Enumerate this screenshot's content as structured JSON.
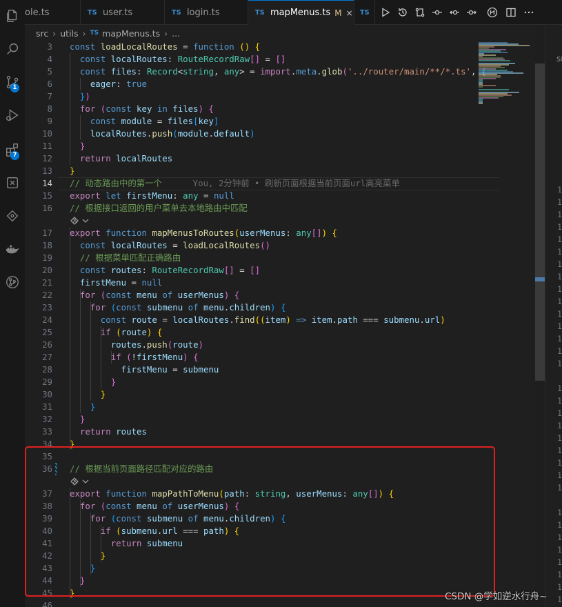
{
  "tabs": [
    {
      "name": "ole.ts",
      "icon": "ts-file-icon",
      "active": false
    },
    {
      "name": "user.ts",
      "icon": "ts-file-icon",
      "active": false
    },
    {
      "name": "login.ts",
      "icon": "ts-file-icon",
      "active": false
    },
    {
      "name": "mapMenus.ts",
      "icon": "ts-file-icon",
      "active": true,
      "modified": "M",
      "close": "×"
    },
    {
      "name": "",
      "icon": "ts-file-icon",
      "active": false
    }
  ],
  "ts_label": "TS",
  "breadcrumb": {
    "parts": [
      "src",
      "utils",
      "mapMenus.ts",
      "..."
    ]
  },
  "activity_badges": {
    "source_control": "1",
    "extensions": "7"
  },
  "editor": {
    "current_line": 14,
    "blame": "You, 2分钟前 • 刷新页面根据当前页面url高亮菜单",
    "lines": [
      {
        "n": "3",
        "html": "<span class=\"k\">const</span> <span class=\"f\">loadLocalRoutes</span> = <span class=\"k\">function</span> <span class=\"b1\">()</span> <span class=\"b1\">{</span>"
      },
      {
        "n": "4",
        "html": "  <span class=\"k\">const</span> <span class=\"v\">localRoutes</span>: <span class=\"t\">RouteRecordRaw</span><span class=\"b2\">[]</span> = <span class=\"b2\">[]</span>"
      },
      {
        "n": "5",
        "html": "  <span class=\"k\">const</span> <span class=\"v\">files</span>: <span class=\"t\">Record</span>&lt;<span class=\"t\">string</span>, <span class=\"t\">any</span>&gt; = <span class=\"kc\">import</span>.<span class=\"k\">meta</span>.<span class=\"f\">glob</span><span class=\"b2\">(</span><span class=\"s\">'../router/main/**/*.ts'</span>, <span class=\"b3\">{</span>"
      },
      {
        "n": "6",
        "html": "    <span class=\"v\">eager</span>: <span class=\"k\">true</span>"
      },
      {
        "n": "7",
        "html": "  <span class=\"b3\">}</span><span class=\"b2\">)</span>"
      },
      {
        "n": "8",
        "html": "  <span class=\"kc\">for</span> <span class=\"b2\">(</span><span class=\"k\">const</span> <span class=\"v\">key</span> <span class=\"k\">in</span> <span class=\"v\">files</span><span class=\"b2\">)</span> <span class=\"b2\">{</span>"
      },
      {
        "n": "9",
        "html": "    <span class=\"k\">const</span> <span class=\"v\">module</span> = <span class=\"v\">files</span><span class=\"b3\">[</span><span class=\"v\">key</span><span class=\"b3\">]</span>"
      },
      {
        "n": "10",
        "html": "    <span class=\"v\">localRoutes</span>.<span class=\"f\">push</span><span class=\"b3\">(</span><span class=\"v\">module</span>.<span class=\"v\">default</span><span class=\"b3\">)</span>"
      },
      {
        "n": "11",
        "html": "  <span class=\"b2\">}</span>"
      },
      {
        "n": "12",
        "html": "  <span class=\"kc\">return</span> <span class=\"v\">localRoutes</span>"
      },
      {
        "n": "13",
        "html": "<span class=\"b1\">}</span>"
      },
      {
        "n": "14",
        "html": "<span class=\"c\">// 动态路由中的第一个</span>      <span class=\"blame\">You, 2分钟前 • 刷新页面根据当前页面url高亮菜单</span>"
      },
      {
        "n": "15",
        "html": "<span class=\"kc\">export</span> <span class=\"k\">let</span> <span class=\"v\">firstMenu</span>: <span class=\"t\">any</span> = <span class=\"k\">null</span>"
      },
      {
        "n": "16",
        "html": "<span class=\"c\">// 根据接口返回的用户菜单去本地路由中匹配</span>"
      },
      {
        "n": "",
        "lens": true
      },
      {
        "n": "17",
        "html": "<span class=\"kc\">export</span> <span class=\"k\">function</span> <span class=\"f\">mapMenusToRoutes</span><span class=\"b1\">(</span><span class=\"v\">userMenus</span>: <span class=\"t\">any</span><span class=\"b2\">[]</span><span class=\"b1\">)</span> <span class=\"b1\">{</span>"
      },
      {
        "n": "18",
        "html": "  <span class=\"k\">const</span> <span class=\"v\">localRoutes</span> = <span class=\"f\">loadLocalRoutes</span><span class=\"b2\">()</span>"
      },
      {
        "n": "19",
        "html": "  <span class=\"c\">// 根据菜单匹配正确路由</span>"
      },
      {
        "n": "20",
        "html": "  <span class=\"k\">const</span> <span class=\"v\">routes</span>: <span class=\"t\">RouteRecordRaw</span><span class=\"b2\">[]</span> = <span class=\"b2\">[]</span>"
      },
      {
        "n": "21",
        "html": "  <span class=\"v\">firstMenu</span> = <span class=\"k\">null</span>"
      },
      {
        "n": "22",
        "html": "  <span class=\"kc\">for</span> <span class=\"b2\">(</span><span class=\"k\">const</span> <span class=\"v\">menu</span> <span class=\"k\">of</span> <span class=\"v\">userMenus</span><span class=\"b2\">)</span> <span class=\"b2\">{</span>"
      },
      {
        "n": "23",
        "html": "    <span class=\"kc\">for</span> <span class=\"b3\">(</span><span class=\"k\">const</span> <span class=\"v\">submenu</span> <span class=\"k\">of</span> <span class=\"v\">menu</span>.<span class=\"v\">children</span><span class=\"b3\">)</span> <span class=\"b3\">{</span>"
      },
      {
        "n": "24",
        "html": "      <span class=\"k\">const</span> <span class=\"v\">route</span> = <span class=\"v\">localRoutes</span>.<span class=\"f\">find</span><span class=\"b1\">((</span><span class=\"v\">item</span><span class=\"b1\">)</span> <span class=\"k\">=&gt;</span> <span class=\"v\">item</span>.<span class=\"v\">path</span> === <span class=\"v\">submenu</span>.<span class=\"v\">url</span><span class=\"b1\">)</span>"
      },
      {
        "n": "25",
        "html": "      <span class=\"kc\">if</span> <span class=\"b1\">(</span><span class=\"v\">route</span><span class=\"b1\">)</span> <span class=\"b1\">{</span>"
      },
      {
        "n": "26",
        "html": "        <span class=\"v\">routes</span>.<span class=\"f\">push</span><span class=\"b2\">(</span><span class=\"v\">route</span><span class=\"b2\">)</span>"
      },
      {
        "n": "27",
        "html": "        <span class=\"kc\">if</span> <span class=\"b2\">(</span>!<span class=\"v\">firstMenu</span><span class=\"b2\">)</span> <span class=\"b2\">{</span>"
      },
      {
        "n": "28",
        "html": "          <span class=\"v\">firstMenu</span> = <span class=\"v\">submenu</span>"
      },
      {
        "n": "29",
        "html": "        <span class=\"b2\">}</span>"
      },
      {
        "n": "30",
        "html": "      <span class=\"b1\">}</span>"
      },
      {
        "n": "31",
        "html": "    <span class=\"b3\">}</span>"
      },
      {
        "n": "32",
        "html": "  <span class=\"b2\">}</span>"
      },
      {
        "n": "33",
        "html": "  <span class=\"kc\">return</span> <span class=\"v\">routes</span>"
      },
      {
        "n": "34",
        "html": "<span class=\"b1\">}</span>"
      },
      {
        "n": "35",
        "html": ""
      },
      {
        "n": "36",
        "html": "<span class=\"c\">// 根据当前页面路径匹配对应的路由</span>",
        "mark": true
      },
      {
        "n": "",
        "lens": true
      },
      {
        "n": "37",
        "html": "<span class=\"kc\">export</span> <span class=\"k\">function</span> <span class=\"f\">mapPathToMenu</span><span class=\"b1\">(</span><span class=\"v\">path</span>: <span class=\"t\">string</span>, <span class=\"v\">userMenus</span>: <span class=\"t\">any</span><span class=\"b2\">[]</span><span class=\"b1\">)</span> <span class=\"b1\">{</span>"
      },
      {
        "n": "38",
        "html": "  <span class=\"kc\">for</span> <span class=\"b2\">(</span><span class=\"k\">const</span> <span class=\"v\">menu</span> <span class=\"k\">of</span> <span class=\"v\">userMenus</span><span class=\"b2\">)</span> <span class=\"b2\">{</span>"
      },
      {
        "n": "39",
        "html": "    <span class=\"kc\">for</span> <span class=\"b3\">(</span><span class=\"k\">const</span> <span class=\"v\">submenu</span> <span class=\"k\">of</span> <span class=\"v\">menu</span>.<span class=\"v\">children</span><span class=\"b3\">)</span> <span class=\"b3\">{</span>"
      },
      {
        "n": "40",
        "html": "      <span class=\"kc\">if</span> <span class=\"b1\">(</span><span class=\"v\">submenu</span>.<span class=\"v\">url</span> === <span class=\"v\">path</span><span class=\"b1\">)</span> <span class=\"b1\">{</span>"
      },
      {
        "n": "41",
        "html": "        <span class=\"kc\">return</span> <span class=\"v\">submenu</span>"
      },
      {
        "n": "42",
        "html": "      <span class=\"b1\">}</span>"
      },
      {
        "n": "43",
        "html": "    <span class=\"b3\">}</span>"
      },
      {
        "n": "44",
        "html": "  <span class=\"b2\">}</span>"
      },
      {
        "n": "45",
        "html": "<span class=\"b1\">}</span>"
      },
      {
        "n": "46",
        "html": ""
      }
    ]
  },
  "right_pane": {
    "label": "sr",
    "line_prefix": "1"
  },
  "watermark": "CSDN @学如逆水行舟~",
  "colors": {
    "accent": "#0078d4",
    "highlight_box": "#e02020",
    "background": "#1f1f1f"
  }
}
